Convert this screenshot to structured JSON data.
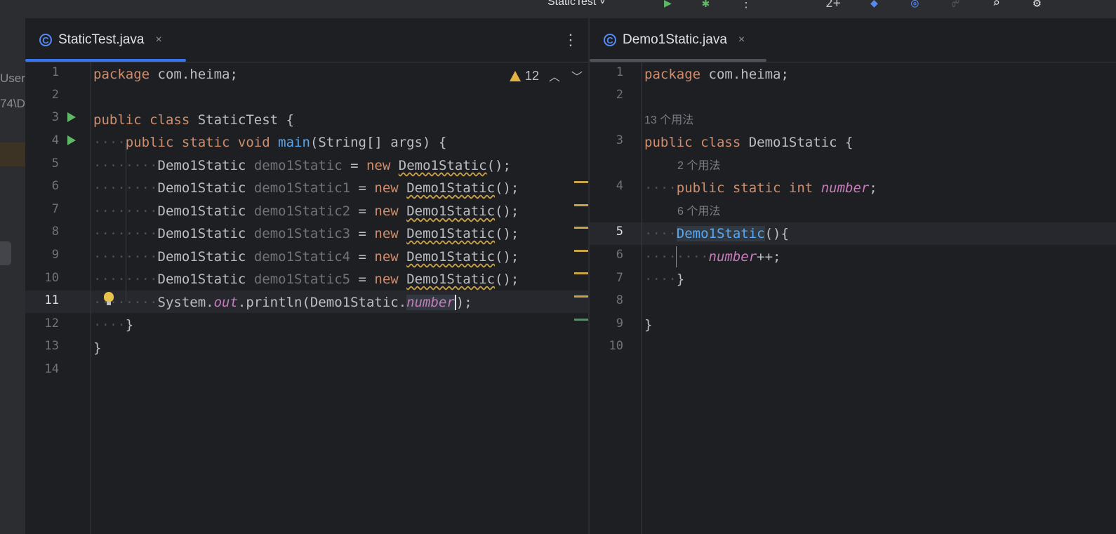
{
  "toolbar": {
    "run_config": "StaticTest ˅",
    "icons": [
      "run-icon",
      "debug-icon",
      "more-icon",
      "add-config-icon",
      "profile-icon",
      "coverage-icon",
      "git-icon",
      "search-icon",
      "settings-icon"
    ]
  },
  "left_strip": {
    "text1": "User",
    "text2": "74\\D"
  },
  "left_editor": {
    "tab_label": "StaticTest.java",
    "tab_icon": "C",
    "close": "×",
    "menu": "⋮",
    "warning_count": "12",
    "line_numbers": [
      "1",
      "2",
      "3",
      "4",
      "5",
      "6",
      "7",
      "8",
      "9",
      "10",
      "11",
      "12",
      "13",
      "14"
    ],
    "current_line": "11",
    "lines": {
      "l1_kw": "package",
      "l1_rest": " com.heima;",
      "l3_kw": "public class",
      "l3_rest": " StaticTest {",
      "l4_kw": "public static void",
      "l4_fn": "main",
      "l4_rest": "(String[] args) {",
      "type": "Demo1Static",
      "vars": [
        "demo1Static",
        "demo1Static1",
        "demo1Static2",
        "demo1Static3",
        "demo1Static4",
        "demo1Static5"
      ],
      "eq": " = ",
      "new_kw": "new",
      "ctor": "Demo1Static",
      "ctor_end": "();",
      "l11_a": "System.",
      "l11_out": "out",
      "l11_b": ".println(Demo1Static.",
      "l11_fld": "number",
      "l11_c": ");",
      "close_brace": "}"
    }
  },
  "right_editor": {
    "tab_label": "Demo1Static.java",
    "tab_icon": "C",
    "close": "×",
    "line_numbers": [
      "1",
      "2",
      "3",
      "4",
      "5",
      "6",
      "7",
      "8",
      "9",
      "10"
    ],
    "current_line": "5",
    "hints": {
      "class_usages": "13 个用法",
      "field_usages": "2 个用法",
      "ctor_usages": "6 个用法"
    },
    "lines": {
      "l1_kw": "package",
      "l1_rest": " com.heima;",
      "l3_kw": "public class",
      "l3_rest": " Demo1Static {",
      "l4_kw": "public static int",
      "l4_fld": "number",
      "l4_end": ";",
      "l5_fn": "Demo1Static",
      "l5_rest": "(){",
      "l6_fld": "number",
      "l6_rest": "++;",
      "close_brace": "}"
    }
  }
}
